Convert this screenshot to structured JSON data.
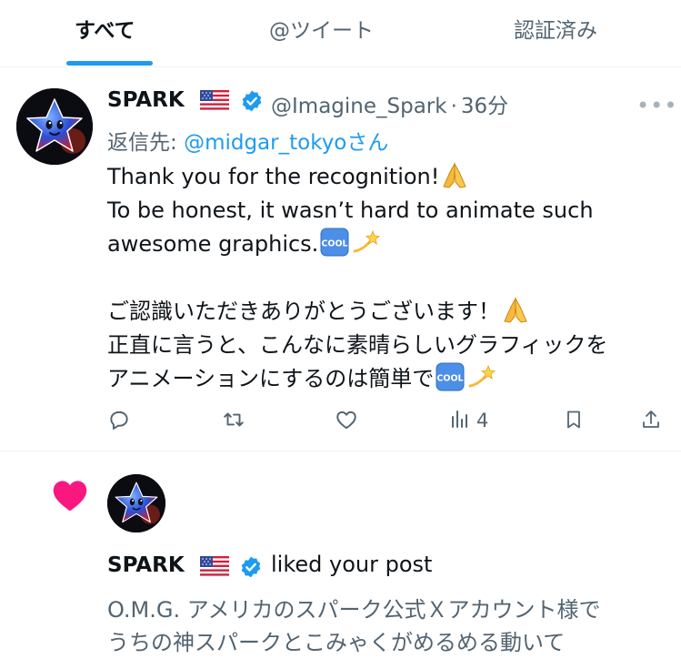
{
  "tabs": [
    {
      "label": "すべて",
      "active": true
    },
    {
      "label": "@ツイート",
      "active": false
    },
    {
      "label": "認証済み",
      "active": false
    }
  ],
  "reply_post": {
    "author_name": "SPARK",
    "flag": "🇺🇸",
    "handle": "@Imagine_Spark",
    "separator": "·",
    "time": "36分",
    "reply_to_prefix": "返信先:",
    "reply_to_user": "@midgar_tokyo",
    "reply_to_suffix": "さん",
    "lines": [
      {
        "text": "Thank you for the recognition!",
        "emojis": [
          "pray"
        ]
      },
      {
        "text": "To be honest, it wasn’t hard to animate such",
        "emojis": []
      },
      {
        "text": "awesome graphics.",
        "emojis": [
          "cool",
          "dizzy"
        ]
      },
      {
        "text": "",
        "emojis": []
      },
      {
        "text": "ご認識いただきありがとうございます！",
        "emojis": [
          "pray"
        ]
      },
      {
        "text": "正直に言うと、こんなに素晴らしいグラフィックを",
        "emojis": []
      },
      {
        "text": "アニメーションにするのは簡単で",
        "emojis": [
          "cool",
          "dizzy"
        ]
      }
    ],
    "actions": {
      "reply_icon": "reply-icon",
      "retweet_icon": "retweet-icon",
      "like_icon": "heart-outline-icon",
      "views_icon": "views-chart-icon",
      "views_count": "4",
      "bookmark_icon": "bookmark-icon",
      "share_icon": "share-icon"
    }
  },
  "notification": {
    "icon": "heart-filled-icon",
    "icon_color": "#f91880",
    "author_name": "SPARK",
    "flag": "🇺🇸",
    "action_text": "liked your post",
    "preview_lines": [
      "O.M.G. アメリカのスパーク公式Ｘアカウント様で",
      "うちの神スパークとこみゃくがめるめる動いて"
    ]
  },
  "colors": {
    "accent": "#1d9bf0",
    "text": "#0f1419",
    "muted": "#536471",
    "like": "#f91880",
    "border": "#eff3f4"
  }
}
